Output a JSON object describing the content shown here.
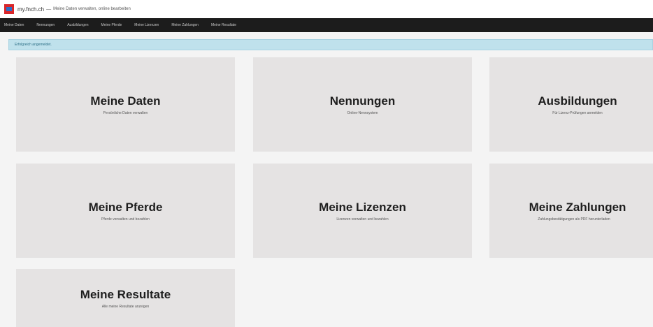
{
  "header": {
    "site_name": "my.fnch.ch",
    "separator": "—",
    "subtitle": "Meine Daten verwalten, online bearbeiten"
  },
  "nav": [
    "Meine Daten",
    "Nennungen",
    "Ausbildungen",
    "Meine Pferde",
    "Meine Lizenzen",
    "Meine Zahlungen",
    "Meine Resultate"
  ],
  "alert": {
    "text": "Erfolgreich angemeldet."
  },
  "tiles": [
    {
      "title": "Meine Daten",
      "description": "Persönliche Daten verwalten"
    },
    {
      "title": "Nennungen",
      "description": "Online-Nennsystem"
    },
    {
      "title": "Ausbildungen",
      "description": "Für Lizenz-Prüfungen anmelden"
    },
    {
      "title": "Meine Pferde",
      "description": "Pferde verwalten und bezahlen"
    },
    {
      "title": "Meine Lizenzen",
      "description": "Lizenzen verwalten und bezahlen"
    },
    {
      "title": "Meine Zahlungen",
      "description": "Zahlungsbestätigungen als PDF herunterladen"
    },
    {
      "title": "Meine Resultate",
      "description": "Alle meine Resultate anzeigen"
    }
  ]
}
